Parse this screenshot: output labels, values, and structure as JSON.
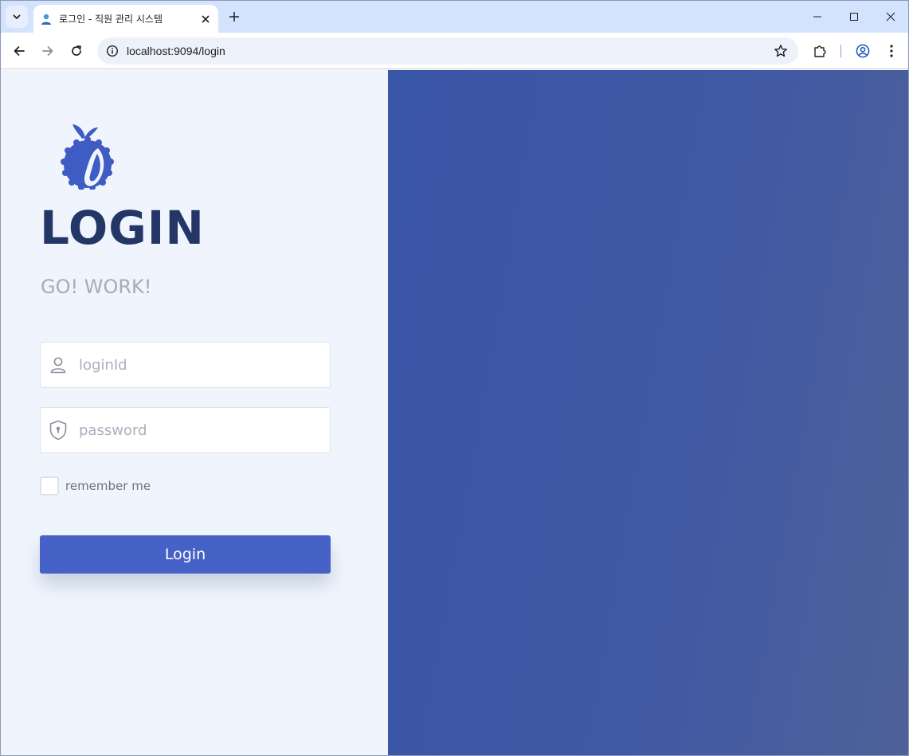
{
  "browser": {
    "tab_title": "로그인 - 직원 관리 시스템",
    "url": "localhost:9094/login"
  },
  "login": {
    "title": "LOGIN",
    "subtitle": "GO! WORK!",
    "id_placeholder": "loginId",
    "id_value": "",
    "password_placeholder": "password",
    "password_value": "",
    "remember_label": "remember me",
    "remember_checked": false,
    "submit_label": "Login"
  },
  "icons": {
    "logo": "blueberry-logo-icon",
    "id_field": "user-icon",
    "password_field": "shield-lock-icon"
  },
  "colors": {
    "brand_dark": "#233666",
    "button": "#4762c6",
    "logo": "#3f5cc4",
    "right_panel": "#3f58a5",
    "left_panel": "#f0f5fd"
  }
}
